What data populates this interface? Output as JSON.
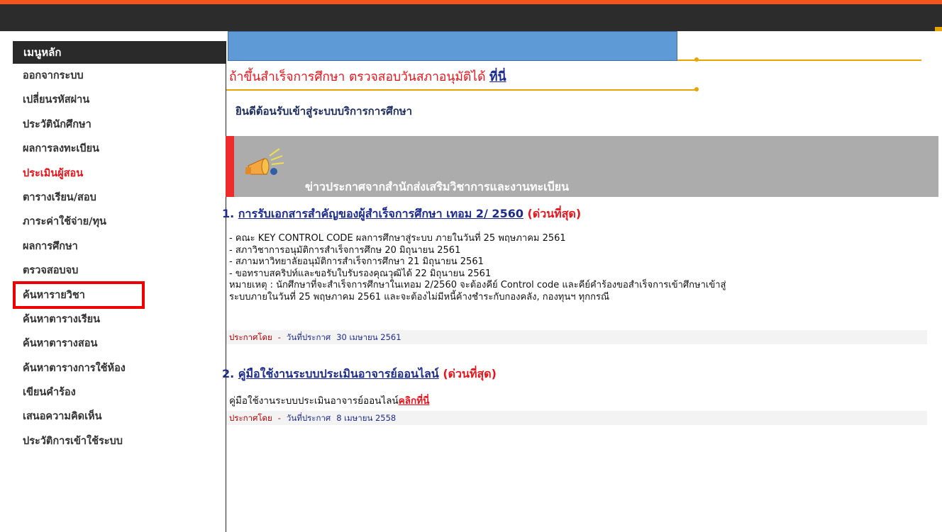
{
  "sidebar": {
    "title": "เมนูหลัก",
    "items": [
      {
        "label": "ออกจากระบบ",
        "name": "sidebar-item-logout"
      },
      {
        "label": "เปลี่ยนรหัสผ่าน",
        "name": "sidebar-item-change-password"
      },
      {
        "label": "ประวัตินักศึกษา",
        "name": "sidebar-item-student-profile"
      },
      {
        "label": "ผลการลงทะเบียน",
        "name": "sidebar-item-registration-result"
      },
      {
        "label": "ประเมินผู้สอน",
        "name": "sidebar-item-evaluate-instructor",
        "color": "#e8141c"
      },
      {
        "label": "ตารางเรียน/สอบ",
        "name": "sidebar-item-class-exam-schedule"
      },
      {
        "label": "ภาระค่าใช้จ่าย/ทุน",
        "name": "sidebar-item-expenses-scholarship"
      },
      {
        "label": "ผลการศึกษา",
        "name": "sidebar-item-grades"
      },
      {
        "label": "ตรวจสอบจบ",
        "name": "sidebar-item-graduation-check",
        "highlighted": true
      },
      {
        "label": "ค้นหารายวิชา",
        "name": "sidebar-item-search-courses"
      },
      {
        "label": "ค้นหาตารางเรียน",
        "name": "sidebar-item-search-class-schedule"
      },
      {
        "label": "ค้นหาตารางสอน",
        "name": "sidebar-item-search-teaching-schedule"
      },
      {
        "label": "ค้นหาตารางการใช้ห้อง",
        "name": "sidebar-item-search-room-schedule"
      },
      {
        "label": "เขียนคำร้อง",
        "name": "sidebar-item-write-petition"
      },
      {
        "label": "เสนอความคิดเห็น",
        "name": "sidebar-item-feedback"
      },
      {
        "label": "ประวัติการเข้าใช้ระบบ",
        "name": "sidebar-item-access-history"
      }
    ]
  },
  "main": {
    "graduate_notice": "ถ้าขึ้นสำเร็จการศึกษา ตรวจสอบวันสภาอนุมัติได้",
    "graduate_link": "ที่นี่",
    "welcome": "ยินดีต้อนรับเข้าสู่ระบบบริการการศึกษา",
    "news_title": "ข่าวประกาศจากสำนักส่งเสริมวิชาการและงานทะเบียน",
    "announcements": [
      {
        "number": "1.",
        "title": "การรับเอกสารสำคัญของผู้สำเร็จการศึกษา เทอม 2/ 2560",
        "urgency": "(ด่วนที่สุด)",
        "lines": [
          "- คณะ KEY CONTROL CODE ผลการศึกษาสู่ระบบ ภายในวันที่ 25 พฤษภาคม 2561",
          "- สภาวิชาการอนุมัติการสำเร็จการศึกษ 20 มิถุนายน 2561",
          "- สภามหาวิทยาลัยอนุมัติการสำเร็จการศึกษา 21 มิถุนายน 2561",
          "- ขอทราบสคริปท์และขอรับใบรับรองคุณวุฒิได้ 22 มิถุนายน 2561",
          "หมายเหตุ : นักศึกษาที่จะสำเร็จการศึกษาในเทอม 2/2560 จะต้องคีย์ Control code และคีย์คำร้องขอสำเร็จการเข้าศึกษาเข้าสู่",
          "ระบบภายในวันที่ 25 พฤษภาคม 2561 และจะต้องไม่มีหนี้ค้างชำระกับกองคลัง, กองทุนฯ ทุกกรณี"
        ],
        "posted_by_label": "ประกาศโดย",
        "date_label": "วันที่ประกาศ",
        "date": "30 เมษายน 2561"
      },
      {
        "number": "2.",
        "title": "คู่มือใช้งานระบบประเมินอาจารย์ออนไลน์",
        "urgency": "(ด่วนที่สุด)",
        "body_text": "คู่มือใช้งานระบบประเมินอาจารย์ออนไลน์",
        "body_link": "คลิกที่นี่",
        "posted_by_label": "ประกาศโดย",
        "date_label": "วันที่ประกาศ",
        "date": "8 เมษายน 2558"
      }
    ]
  },
  "colors": {
    "header_dark": "#2c2c2c",
    "header_orange": "#f0561e",
    "accent_gold": "#e8a400",
    "banner_blue": "#5d9ad6",
    "news_gray": "#acacac",
    "alert_red": "#e8141c",
    "link_navy": "#1d2b8c"
  }
}
